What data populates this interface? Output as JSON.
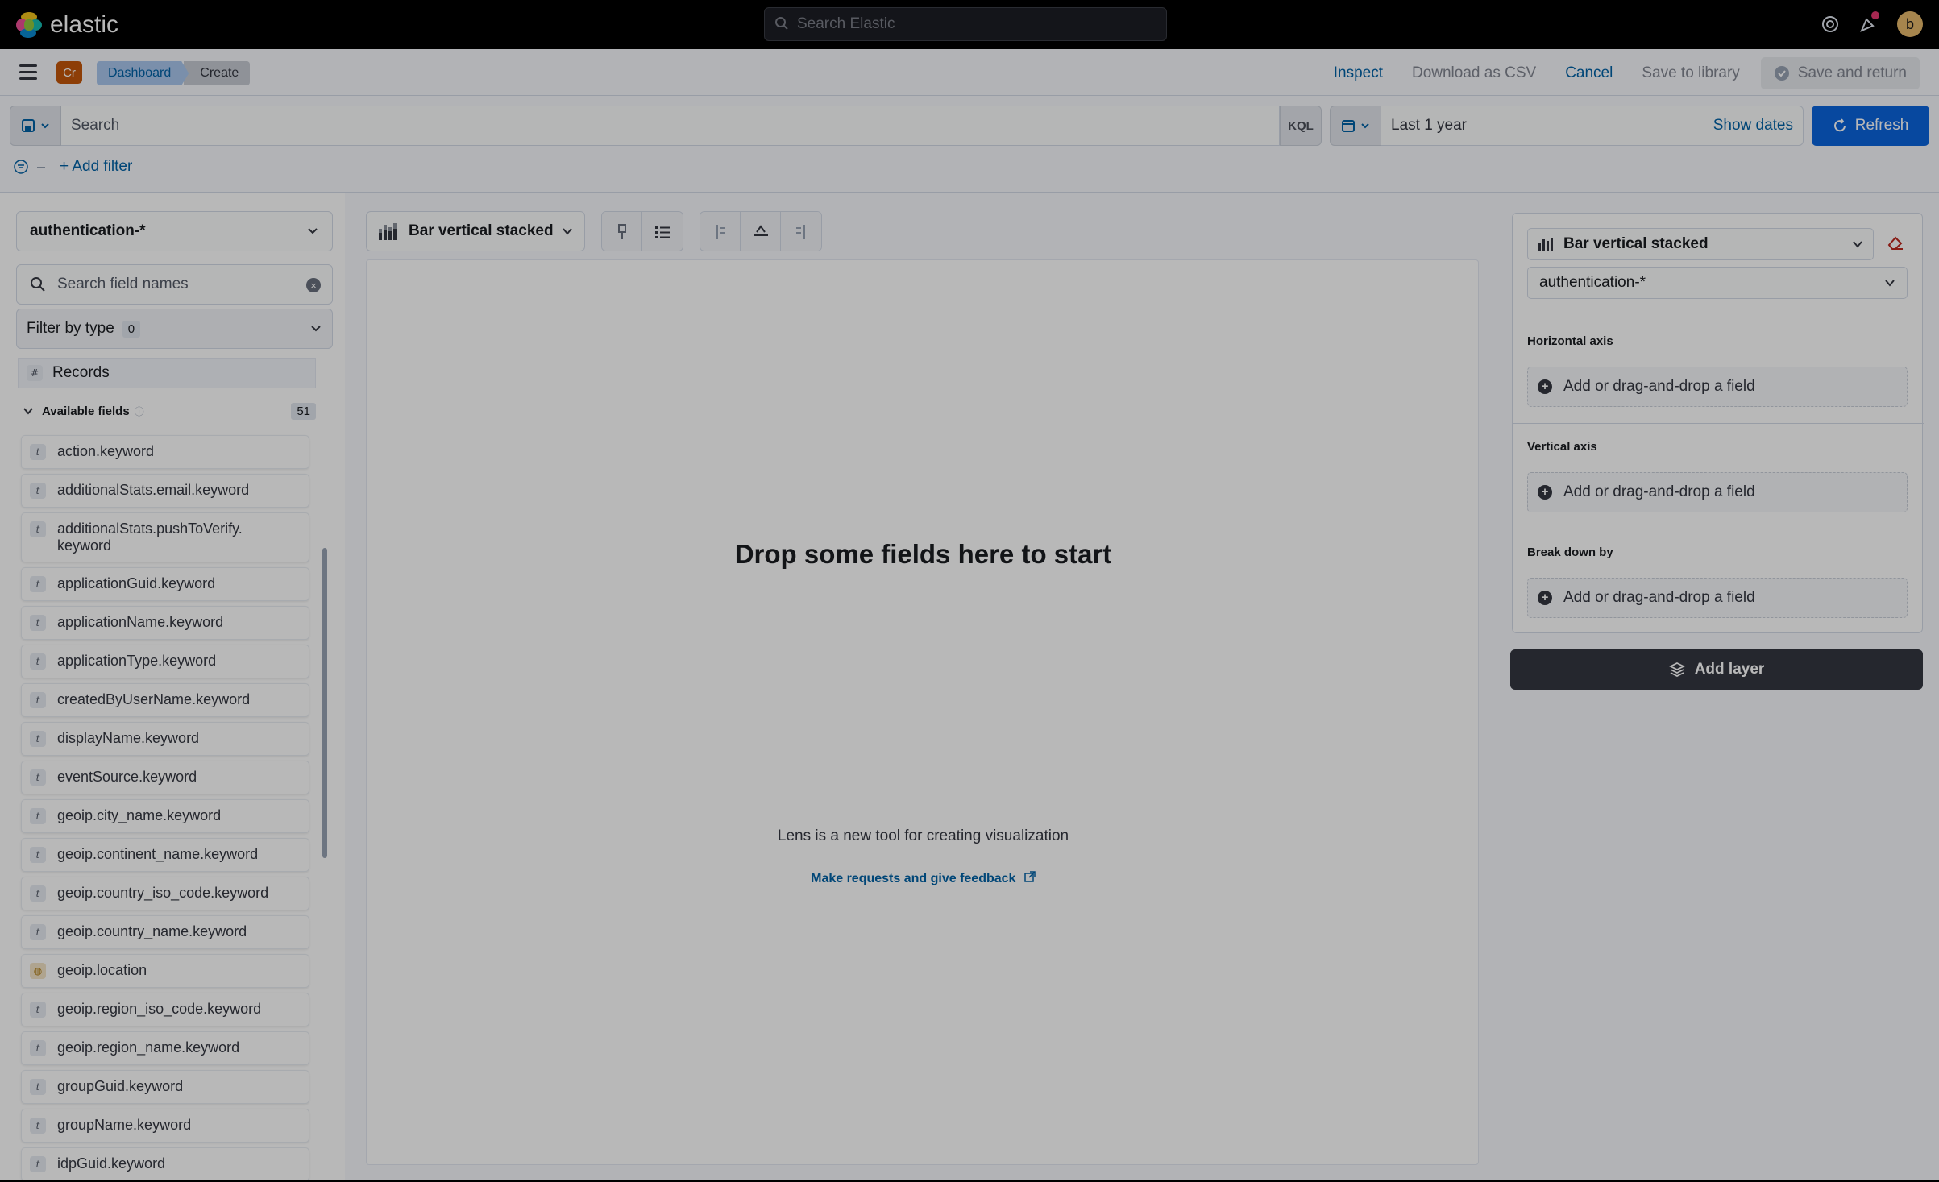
{
  "brand": {
    "name": "elastic"
  },
  "global_search": {
    "placeholder": "Search Elastic"
  },
  "user": {
    "initial": "b"
  },
  "space": {
    "badge": "Cr"
  },
  "breadcrumbs": [
    {
      "label": "Dashboard"
    },
    {
      "label": "Create"
    }
  ],
  "app_actions": {
    "inspect": "Inspect",
    "download_csv": "Download as CSV",
    "cancel": "Cancel",
    "save_to_library": "Save to library",
    "save_and_return": "Save and return"
  },
  "query": {
    "placeholder": "Search",
    "language": "KQL"
  },
  "time": {
    "range": "Last 1 year",
    "show_dates": "Show dates",
    "refresh": "Refresh"
  },
  "filters": {
    "add_filter": "+ Add filter"
  },
  "datasource": {
    "index_pattern": "authentication-*",
    "search_placeholder": "Search field names",
    "filter_by_type": "Filter by type",
    "filter_count": "0",
    "records": "Records",
    "available_fields_label": "Available fields",
    "available_fields_count": "51",
    "fields": [
      {
        "name": "action.keyword",
        "type": "t"
      },
      {
        "name": "additionalStats.email.keyword",
        "type": "t"
      },
      {
        "name": "additionalStats.pushToVerify.",
        "name2": "keyword",
        "type": "t"
      },
      {
        "name": "applicationGuid.keyword",
        "type": "t"
      },
      {
        "name": "applicationName.keyword",
        "type": "t"
      },
      {
        "name": "applicationType.keyword",
        "type": "t"
      },
      {
        "name": "createdByUserName.keyword",
        "type": "t"
      },
      {
        "name": "displayName.keyword",
        "type": "t"
      },
      {
        "name": "eventSource.keyword",
        "type": "t"
      },
      {
        "name": "geoip.city_name.keyword",
        "type": "t"
      },
      {
        "name": "geoip.continent_name.keyword",
        "type": "t"
      },
      {
        "name": "geoip.country_iso_code.keyword",
        "type": "t"
      },
      {
        "name": "geoip.country_name.keyword",
        "type": "t"
      },
      {
        "name": "geoip.location",
        "type": "geo"
      },
      {
        "name": "geoip.region_iso_code.keyword",
        "type": "t"
      },
      {
        "name": "geoip.region_name.keyword",
        "type": "t"
      },
      {
        "name": "groupGuid.keyword",
        "type": "t"
      },
      {
        "name": "groupName.keyword",
        "type": "t"
      },
      {
        "name": "idpGuid.keyword",
        "type": "t"
      }
    ]
  },
  "workspace": {
    "chart_type": "Bar vertical stacked",
    "drop_title": "Drop some fields here to start",
    "lens_note": "Lens is a new tool for creating visualization",
    "feedback_link": "Make requests and give feedback"
  },
  "config": {
    "chart_type": "Bar vertical stacked",
    "index_pattern": "authentication-*",
    "horizontal_axis": "Horizontal axis",
    "vertical_axis": "Vertical axis",
    "break_down_by": "Break down by",
    "slot_placeholder": "Add or drag-and-drop a field",
    "add_layer": "Add layer"
  },
  "colors": {
    "accent": "#0b64dd",
    "link": "#0061a6",
    "dark_button": "#343741"
  }
}
